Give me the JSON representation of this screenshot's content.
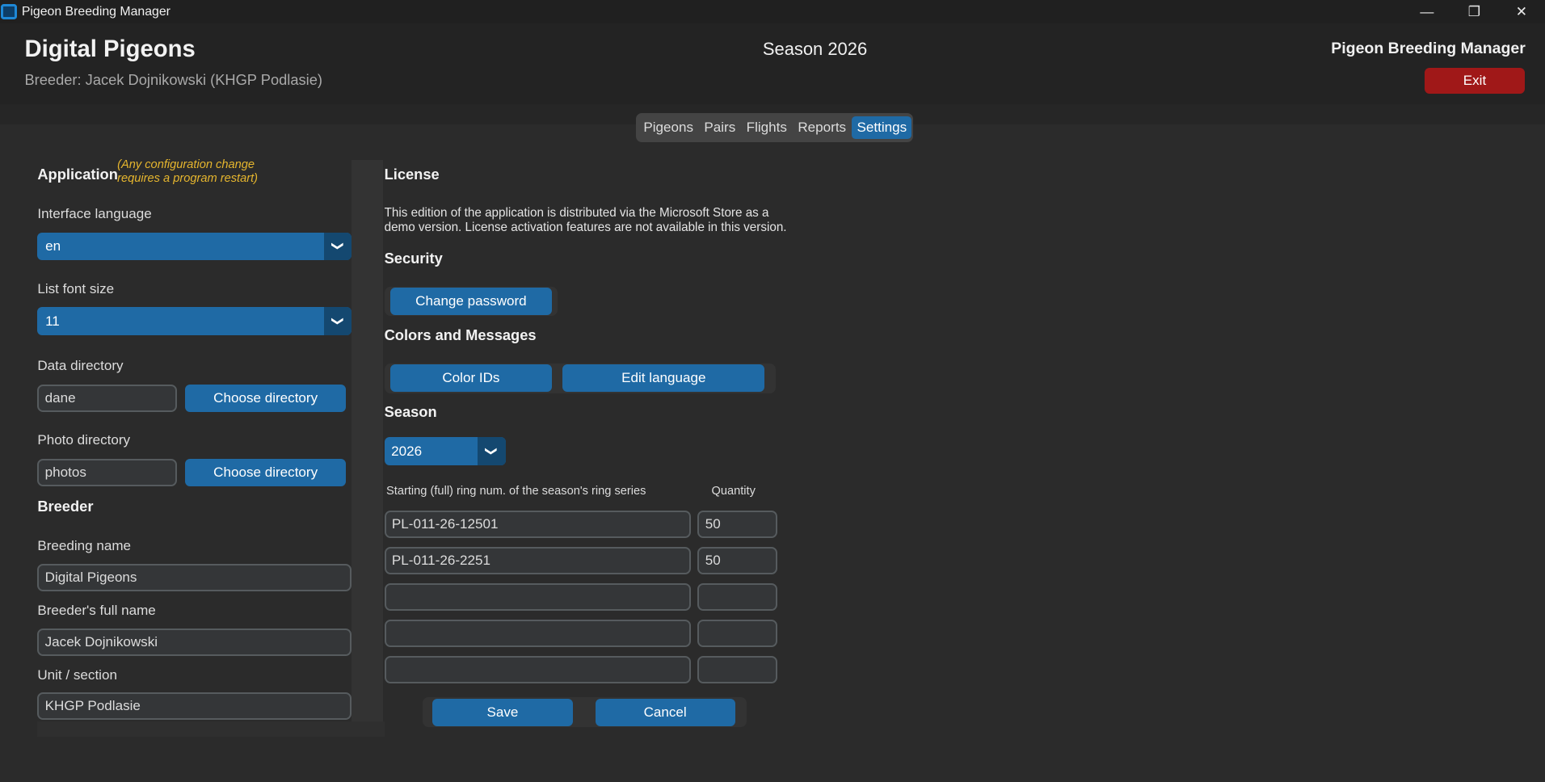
{
  "window": {
    "title": "Pigeon Breeding Manager",
    "controls": {
      "minimize": "—",
      "restore": "❐",
      "close": "✕"
    }
  },
  "header": {
    "breeding_name": "Digital Pigeons",
    "breeder_line": "Breeder: Jacek Dojnikowski (KHGP Podlasie)",
    "season": "Season 2026",
    "app_name": "Pigeon Breeding Manager",
    "exit_label": "Exit"
  },
  "tabs": [
    {
      "label": "Pigeons",
      "active": false
    },
    {
      "label": "Pairs",
      "active": false
    },
    {
      "label": "Flights",
      "active": false
    },
    {
      "label": "Reports",
      "active": false
    },
    {
      "label": "Settings",
      "active": true
    }
  ],
  "application": {
    "title": "Application",
    "note": "(Any configuration change requires a program restart)",
    "interface_language_label": "Interface language",
    "interface_language_value": "en",
    "list_font_size_label": "List font size",
    "list_font_size_value": "11",
    "data_directory_label": "Data directory",
    "data_directory_value": "dane",
    "photo_directory_label": "Photo directory",
    "photo_directory_value": "photos",
    "choose_directory_label": "Choose directory"
  },
  "breeder": {
    "title": "Breeder",
    "breeding_name_label": "Breeding name",
    "breeding_name_value": "Digital Pigeons",
    "full_name_label": "Breeder's full name",
    "full_name_value": "Jacek Dojnikowski",
    "unit_label": "Unit / section",
    "unit_value": "KHGP Podlasie"
  },
  "license": {
    "title": "License",
    "text": "This edition of the application is distributed via the Microsoft Store as a demo version. License activation features are not available in this version."
  },
  "security": {
    "title": "Security",
    "change_password_label": "Change password"
  },
  "colors_messages": {
    "title": "Colors and Messages",
    "color_ids_label": "Color IDs",
    "edit_language_label": "Edit language"
  },
  "season": {
    "title": "Season",
    "selected": "2026",
    "ring_header": "Starting (full) ring num. of the season's ring series",
    "quantity_header": "Quantity",
    "rows": [
      {
        "ring": "PL-011-26-12501",
        "qty": "50"
      },
      {
        "ring": "PL-011-26-2251",
        "qty": "50"
      },
      {
        "ring": "",
        "qty": ""
      },
      {
        "ring": "",
        "qty": ""
      },
      {
        "ring": "",
        "qty": ""
      }
    ],
    "save_label": "Save",
    "cancel_label": "Cancel"
  },
  "icons": {
    "chevron": "❯",
    "app": "app-icon"
  },
  "colors": {
    "accent": "#1f6aa5",
    "exit": "#a01818",
    "note": "#e6b62e",
    "background": "#2b2b2b"
  }
}
